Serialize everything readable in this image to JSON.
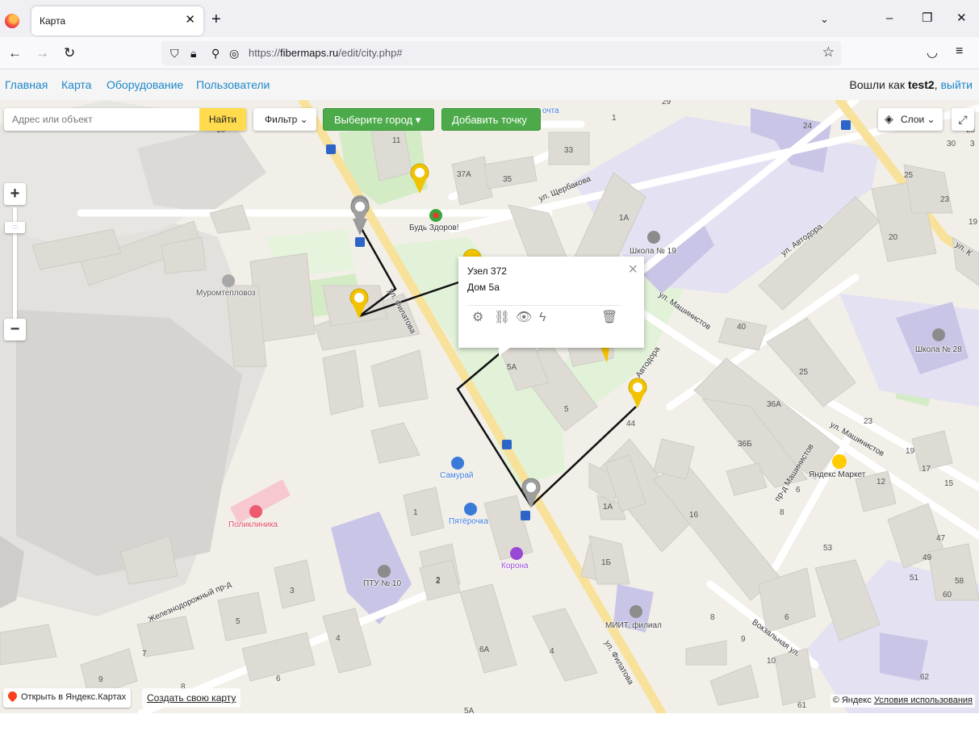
{
  "browser": {
    "tab_title": "Карта",
    "url_domain": "fibermaps.ru",
    "url_scheme": "https://",
    "url_path": "/edit/city.php#"
  },
  "site_nav": {
    "items": [
      {
        "label": "Главная"
      },
      {
        "label": "Карта"
      },
      {
        "label": "Оборудование"
      },
      {
        "label": "Пользователи"
      }
    ],
    "login_prefix": "Вошли как ",
    "username": "test2",
    "separator": ", ",
    "logout_label": "выйти"
  },
  "map_controls": {
    "search_placeholder": "Адрес или объект",
    "search_button": "Найти",
    "filter_label": "Фильтр",
    "city_select_label": "Выберите город",
    "add_point_label": "Добавить точку",
    "layers_label": "Слои"
  },
  "popup": {
    "title": "Узел 372",
    "address": "Дом 5а"
  },
  "map_labels": {
    "streets": {
      "filatova_1": "ул. Филатова",
      "filatova_2": "ул. Филатова",
      "shcherbakova": "ул. Щербакова",
      "avtodora_1": "ул. Автодора",
      "avtodora_2": "Автодора",
      "mashinistov_1": "ул. Машинистов",
      "mashinistov_2": "ул. Машинистов",
      "pr_mashinistov": "пр-д Машинистов",
      "zheleznodorozhny": "Железнодорожный пр-д",
      "vokzalnaya": "Вокзальная ул.",
      "ul_k": "ул. К"
    },
    "pois": {
      "bud_zdorov": "Будь Здоров!",
      "muromteplovoz": "Муромтепловоз",
      "shkola19": "Школа № 19",
      "shkola28": "Школа № 28",
      "samurai": "Самурай",
      "pyaterochka": "Пятёрочка",
      "korona": "Корона",
      "poliklinika": "Поликлиника",
      "ptu10": "ПТУ № 10",
      "miit": "МИИТ, филиал",
      "yandex_market": "Яндекс Маркет",
      "pochta": "очта"
    },
    "house_numbers": [
      "10",
      "11",
      "37А",
      "35",
      "33",
      "1",
      "29",
      "24",
      "30",
      "3",
      "28",
      "25",
      "23",
      "19",
      "1А",
      "20",
      "40",
      "25",
      "36А",
      "36Б",
      "23",
      "19",
      "17",
      "15",
      "5А",
      "5",
      "44",
      "2",
      "12",
      "6",
      "8",
      "1А",
      "16",
      "1Б",
      "53",
      "47",
      "49",
      "51",
      "58",
      "60",
      "1",
      "2",
      "3",
      "5",
      "6",
      "7",
      "8",
      "9",
      "4",
      "6А",
      "4",
      "8",
      "9",
      "10",
      "6",
      "62",
      "61",
      "5А"
    ]
  },
  "footer": {
    "open_yandex": "Открыть в Яндекс.Картах",
    "create_map": "Создать свою карту",
    "copyright": "© Яндекс ",
    "terms": "Условия использования"
  }
}
